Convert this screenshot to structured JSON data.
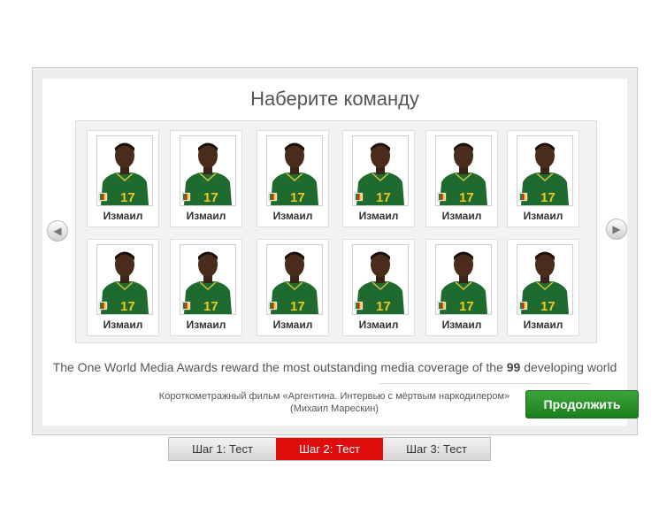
{
  "title": "Наберите команду",
  "players": [
    {
      "name": "Измаил",
      "number": "17"
    },
    {
      "name": "Измаил",
      "number": "17"
    },
    {
      "name": "Измаил",
      "number": "17"
    },
    {
      "name": "Измаил",
      "number": "17"
    },
    {
      "name": "Измаил",
      "number": "17"
    },
    {
      "name": "Измаил",
      "number": "17"
    },
    {
      "name": "Измаил",
      "number": "17"
    },
    {
      "name": "Измаил",
      "number": "17"
    },
    {
      "name": "Измаил",
      "number": "17"
    },
    {
      "name": "Измаил",
      "number": "17"
    },
    {
      "name": "Измаил",
      "number": "17"
    },
    {
      "name": "Измаил",
      "number": "17"
    }
  ],
  "description": {
    "before": "The One World Media Awards reward the most outstanding media coverage of the ",
    "highlight": "99",
    "after": " developing world"
  },
  "film": {
    "line1": "Короткометражный фильм «Аргентина. Интервью с мёртвым наркодилером»",
    "line2": "(Михаил Марескин)"
  },
  "continue_label": "Продолжить",
  "steps": [
    {
      "label": "Шаг 1: Тест",
      "active": false
    },
    {
      "label": "Шаг 2: Тест",
      "active": true
    },
    {
      "label": "Шаг 3: Тест",
      "active": false
    }
  ],
  "colors": {
    "jersey": "#1f6b2f",
    "number": "#f2c81a",
    "button": "#2a922a",
    "active_step": "#e10d0d"
  }
}
